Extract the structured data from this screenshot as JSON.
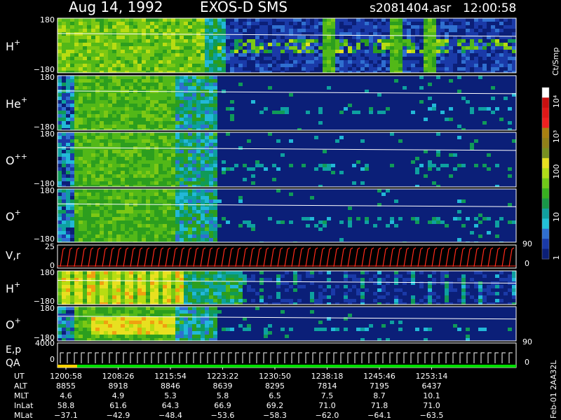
{
  "header": {
    "date": "Aug 14, 1992",
    "instrument": "EXOS-D SMS",
    "file": "s2081404.asr",
    "time": "12:00:58"
  },
  "colors": {
    "background": "#000000",
    "panel_low": "#0b1f78",
    "trace_line": "#ffffff",
    "velocity_marks": "#ff2a1a",
    "qa_good": "#00e000",
    "qa_flag": "#ffd400"
  },
  "chart_data": {
    "type": "heatmap",
    "panels": [
      {
        "id": "h-plus-1",
        "label": "H",
        "sup": "+",
        "ytop": "180",
        "ybot": "−180",
        "ylim": [
          -180,
          180
        ],
        "activity": "high"
      },
      {
        "id": "he-plus",
        "label": "He",
        "sup": "+",
        "ytop": "180",
        "ybot": "−180",
        "ylim": [
          -180,
          180
        ],
        "activity": "low"
      },
      {
        "id": "o-plus-plus",
        "label": "O",
        "sup": "++",
        "ytop": "180",
        "ybot": "−180",
        "ylim": [
          -180,
          180
        ],
        "activity": "low"
      },
      {
        "id": "o-plus-1",
        "label": "O",
        "sup": "+",
        "ytop": "180",
        "ybot": "−180",
        "ylim": [
          -180,
          180
        ],
        "activity": "low"
      },
      {
        "id": "h-plus-2",
        "label": "H",
        "sup": "+",
        "ytop": "180",
        "ybot": "−180",
        "ylim": [
          -180,
          180
        ],
        "activity": "stripes"
      },
      {
        "id": "o-plus-2",
        "label": "O",
        "sup": "+",
        "ytop": "180",
        "ybot": "−180",
        "ylim": [
          -180,
          180
        ],
        "activity": "low"
      }
    ],
    "velocity_panel": {
      "label": "V,r",
      "ytop": "25",
      "ybot": "0",
      "right_top": "90",
      "right_bot": "0"
    },
    "energy_panel": {
      "label": "E,p",
      "label2": "QA",
      "ytop": "4000",
      "ybot": "0",
      "right_top": "90",
      "right_bot": "0"
    },
    "colorbar": {
      "unit": "Ct/Smp",
      "scale": "log",
      "range": [
        1,
        10000
      ],
      "tick_labels": [
        "10⁴",
        "10³",
        "100",
        "10",
        "1"
      ]
    },
    "time_axis": {
      "row_labels": [
        "UT",
        "ALT",
        "MLT",
        "InLat",
        "MLat"
      ],
      "columns": [
        {
          "UT": "1200:58",
          "ALT": "8855",
          "MLT": "4.6",
          "InLat": "58.8",
          "MLat": "−37.1"
        },
        {
          "UT": "1208:26",
          "ALT": "8918",
          "MLT": "4.9",
          "InLat": "61.6",
          "MLat": "−42.9"
        },
        {
          "UT": "1215:54",
          "ALT": "8846",
          "MLT": "5.3",
          "InLat": "64.3",
          "MLat": "−48.4"
        },
        {
          "UT": "1223:22",
          "ALT": "8639",
          "MLT": "5.8",
          "InLat": "66.9",
          "MLat": "−53.6"
        },
        {
          "UT": "1230:50",
          "ALT": "8295",
          "MLT": "6.5",
          "InLat": "69.2",
          "MLat": "−58.3"
        },
        {
          "UT": "1238:18",
          "ALT": "7814",
          "MLT": "7.5",
          "InLat": "71.0",
          "MLat": "−62.0"
        },
        {
          "UT": "1245:46",
          "ALT": "7195",
          "MLT": "8.7",
          "InLat": "71.8",
          "MLat": "−64.1"
        },
        {
          "UT": "1253:14",
          "ALT": "6437",
          "MLT": "10.1",
          "InLat": "71.0",
          "MLat": "−63.5"
        }
      ]
    }
  },
  "footer": {
    "stamp": "Feb-01 2AA32L"
  }
}
